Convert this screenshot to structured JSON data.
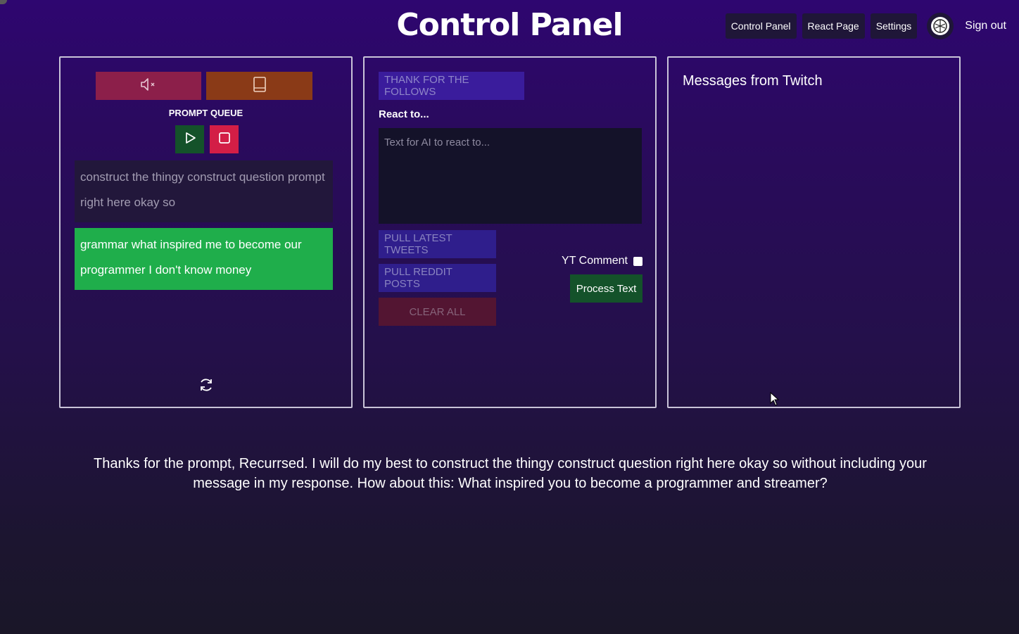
{
  "header": {
    "title": "Control Panel",
    "nav": [
      "Control Panel",
      "React Page",
      "Settings"
    ],
    "sign_out": "Sign out"
  },
  "prompt_queue": {
    "label": "PROMPT QUEUE",
    "items": [
      "construct the thingy construct question prompt right here okay so",
      "grammar what inspired me to become our programmer I don't know money"
    ]
  },
  "react_panel": {
    "thank_button": "THANK FOR THE FOLLOWS",
    "react_label": "React to...",
    "textarea_placeholder": "Text for AI to react to...",
    "pull_tweets": "PULL LATEST TWEETS",
    "pull_reddit": "PULL REDDIT POSTS",
    "clear_all": "CLEAR ALL",
    "yt_comment_label": "YT Comment",
    "process_text": "Process Text"
  },
  "twitch_panel": {
    "title": "Messages from Twitch"
  },
  "response": {
    "text": "Thanks for the prompt, Recurrsed. I will do my best to construct the thingy construct question right here okay so without including your message in my response. How about this: What inspired you to become a programmer and streamer?"
  },
  "colors": {
    "mute_button": "#8c1f4a",
    "tablet_button": "#8a3a17",
    "play_button": "#14522a",
    "stop_button": "#d31e46",
    "active_queue_item": "#1fae4b",
    "process_button": "#14522a"
  },
  "icons": [
    "mute-icon",
    "tablet-icon",
    "play-icon",
    "stop-icon",
    "refresh-icon",
    "avatar-icon",
    "mouse-cursor-icon"
  ]
}
